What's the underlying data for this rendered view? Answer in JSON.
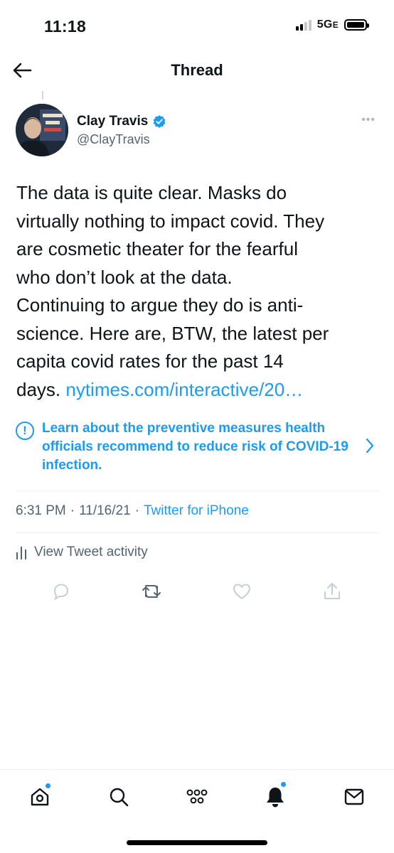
{
  "status_bar": {
    "time": "11:18",
    "network": "5G",
    "network_suffix": "E"
  },
  "header": {
    "title": "Thread",
    "back_icon": "arrow-left-icon"
  },
  "tweet": {
    "author": {
      "name": "Clay Travis",
      "handle": "@ClayTravis",
      "verified": true
    },
    "text": "The data is quite clear. Masks do\nvirtually nothing to impact covid. They\nare cosmetic theater for the fearful\nwho don’t look at the data.\nContinuing to argue they do is anti-\nscience. Here are, BTW, the latest per\ncapita covid rates for the past 14\ndays. ",
    "link": "nytimes.com/interactive/20…",
    "notice": {
      "icon": "!",
      "text": "Learn about the preventive measures health officials recommend to reduce risk of COVID-19 infection."
    },
    "time": "6:31 PM",
    "date": "11/16/21",
    "source": "Twitter for iPhone",
    "activity_label": "View Tweet activity"
  },
  "actions": [
    "reply-icon",
    "retweet-icon",
    "like-icon",
    "share-icon"
  ],
  "bottom_nav": [
    "home-icon",
    "search-icon",
    "spaces-icon",
    "notifications-icon",
    "messages-icon"
  ],
  "colors": {
    "accent": "#1d9bf0",
    "text": "#0f1419",
    "secondary": "#536471",
    "divider": "#eff3f4"
  }
}
